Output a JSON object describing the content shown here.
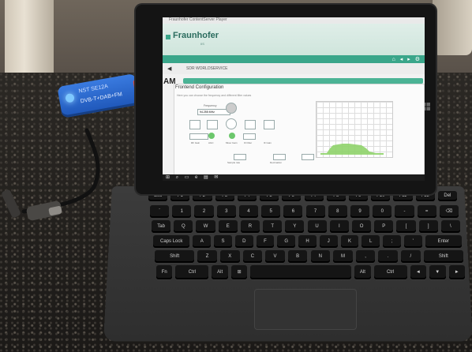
{
  "photo": {
    "dongle": {
      "line1": "NST SE12A",
      "line2": "DVB-T+DAB+FM"
    },
    "screen": {
      "window_title": "Fraunhofer ContentServer Player",
      "brand": "Fraunhofer",
      "brand_sub": "IIS",
      "nav_label": "SDR WORLDSERVICE",
      "am_label": "AM",
      "panel_title": "Frontend Configuration",
      "panel_desc": "Here you can choose the frequency and different filter values",
      "frequency_label": "Frequency",
      "frequency_value": "94.255 MHz",
      "rf_gain": "RF Gain",
      "agc": "AGC",
      "mixer_gain": "Mixer Gain",
      "if_filter": "IF Filter",
      "if_gain": "IF Gain",
      "sample_rate": "Sample rate",
      "decimation": "Decimation"
    },
    "keyboard": {
      "keys_row1": [
        "Esc",
        "F1",
        "F2",
        "F3",
        "F4",
        "F5",
        "F6",
        "F7",
        "F8",
        "F9",
        "F10",
        "F11",
        "F12",
        "Del"
      ],
      "keys_row2": [
        "`",
        "1",
        "2",
        "3",
        "4",
        "5",
        "6",
        "7",
        "8",
        "9",
        "0",
        "-",
        "=",
        "⌫"
      ],
      "keys_row3": [
        "Tab",
        "Q",
        "W",
        "E",
        "R",
        "T",
        "Y",
        "U",
        "I",
        "O",
        "P",
        "[",
        "]",
        "\\"
      ],
      "keys_row4": [
        "Caps Lock",
        "A",
        "S",
        "D",
        "F",
        "G",
        "H",
        "J",
        "K",
        "L",
        ";",
        "'",
        "Enter"
      ],
      "keys_row5": [
        "Shift",
        "Z",
        "X",
        "C",
        "V",
        "B",
        "N",
        "M",
        ",",
        ".",
        "/",
        "Shift"
      ],
      "keys_row6": [
        "Fn",
        "Ctrl",
        "Alt",
        "⊞",
        "",
        "Alt",
        "Ctrl",
        "◄",
        "▼",
        "►"
      ]
    }
  }
}
